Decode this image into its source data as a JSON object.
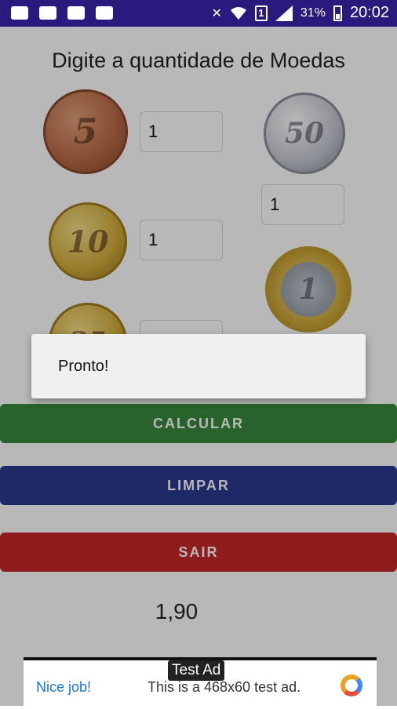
{
  "status_bar": {
    "battery": "31%",
    "sim": "1",
    "time": "20:02",
    "icons": [
      "image-icon",
      "youtube-icon",
      "voicemail-icon",
      "mail-icon",
      "mute-icon",
      "wifi-icon",
      "signal-icon",
      "battery-icon"
    ]
  },
  "app": {
    "title": "Digite a quantidade de Moedas",
    "coins": [
      {
        "name": "5 centavos",
        "label": "5",
        "quantity": "1"
      },
      {
        "name": "50 centavos",
        "label": "50",
        "quantity": "1"
      },
      {
        "name": "10 centavos",
        "label": "10",
        "quantity": "1"
      },
      {
        "name": "1 real",
        "label": "1"
      },
      {
        "name": "25 centavos",
        "label": "25"
      }
    ],
    "buttons": {
      "calcular": "CALCULAR",
      "limpar": "LIMPAR",
      "sair": "SAIR"
    },
    "result": "1,90",
    "colors": {
      "calcular": "#3a8a3e",
      "limpar": "#2b3a8f",
      "sair": "#c62828",
      "status_bar": "#2a1a7e"
    }
  },
  "dialog": {
    "message": "Pronto!"
  },
  "ad": {
    "tag": "Test Ad",
    "cta": "Nice job!",
    "description": "This is a 468x60 test ad."
  }
}
